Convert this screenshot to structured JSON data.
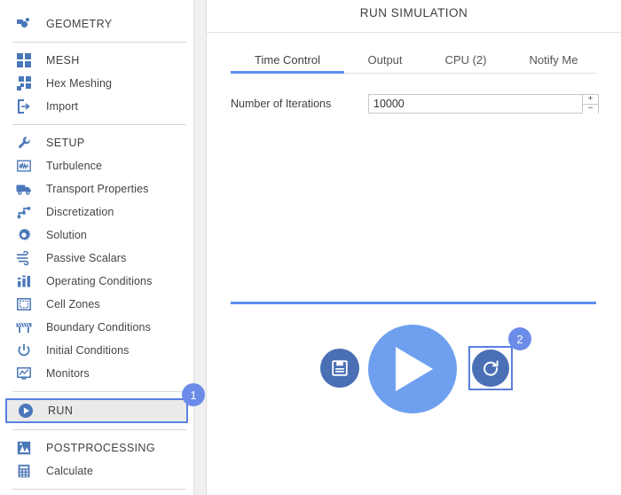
{
  "sidebar": {
    "groups": [
      {
        "items": [
          {
            "label": "GEOMETRY",
            "icon": "geometry-icon",
            "section": true,
            "selected": false
          }
        ]
      },
      {
        "items": [
          {
            "label": "MESH",
            "icon": "mesh-grid-icon",
            "section": true,
            "selected": false
          },
          {
            "label": "Hex Meshing",
            "icon": "hex-meshing-icon",
            "section": false,
            "selected": false
          },
          {
            "label": "Import",
            "icon": "import-icon",
            "section": false,
            "selected": false
          }
        ]
      },
      {
        "items": [
          {
            "label": "SETUP",
            "icon": "wrench-icon",
            "section": true,
            "selected": false
          },
          {
            "label": "Turbulence",
            "icon": "turbulence-waveform-icon",
            "section": false,
            "selected": false
          },
          {
            "label": "Transport Properties",
            "icon": "truck-icon",
            "section": false,
            "selected": false
          },
          {
            "label": "Discretization",
            "icon": "discretization-icon",
            "section": false,
            "selected": false
          },
          {
            "label": "Solution",
            "icon": "gear-icon",
            "section": false,
            "selected": false
          },
          {
            "label": "Passive Scalars",
            "icon": "wind-icon",
            "section": false,
            "selected": false
          },
          {
            "label": "Operating Conditions",
            "icon": "bar-chart-icon",
            "section": false,
            "selected": false
          },
          {
            "label": "Cell Zones",
            "icon": "cell-zones-icon",
            "section": false,
            "selected": false
          },
          {
            "label": "Boundary Conditions",
            "icon": "barrier-icon",
            "section": false,
            "selected": false
          },
          {
            "label": "Initial Conditions",
            "icon": "power-icon",
            "section": false,
            "selected": false
          },
          {
            "label": "Monitors",
            "icon": "monitor-chart-icon",
            "section": false,
            "selected": false
          }
        ]
      },
      {
        "items": [
          {
            "label": "RUN",
            "icon": "play-circle-icon",
            "section": true,
            "selected": true
          }
        ]
      },
      {
        "items": [
          {
            "label": "POSTPROCESSING",
            "icon": "postprocessing-icon",
            "section": true,
            "selected": false
          },
          {
            "label": "Calculate",
            "icon": "calculator-icon",
            "section": false,
            "selected": false
          }
        ]
      }
    ]
  },
  "panel": {
    "title": "RUN SIMULATION",
    "tabs": [
      {
        "label": "Time Control",
        "active": true
      },
      {
        "label": "Output",
        "active": false
      },
      {
        "label": "CPU  (2)",
        "active": false
      },
      {
        "label": "Notify Me",
        "active": false
      }
    ],
    "form": {
      "iterations_label": "Number of Iterations",
      "iterations_value": "10000",
      "iterations_placeholder": "",
      "spinner_up": "+",
      "spinner_down": "−"
    },
    "actions": {
      "save_label": "save-configuration",
      "play_label": "run-simulation",
      "reset_label": "reset-simulation"
    }
  },
  "badges": [
    {
      "id": "1",
      "target": "sidebar-item-run"
    },
    {
      "id": "2",
      "target": "reset-button"
    }
  ],
  "colors": {
    "accent_blue": "#5b8def",
    "play_blue": "#6ea0ef",
    "dark_blue": "#4a6fb5",
    "icon_blue": "#4a77b8",
    "badge_blue": "#6b8ce8",
    "highlight_border": "#5b7ee0",
    "selected_row_bg": "#eaeaea",
    "text": "#3f3f3f"
  }
}
